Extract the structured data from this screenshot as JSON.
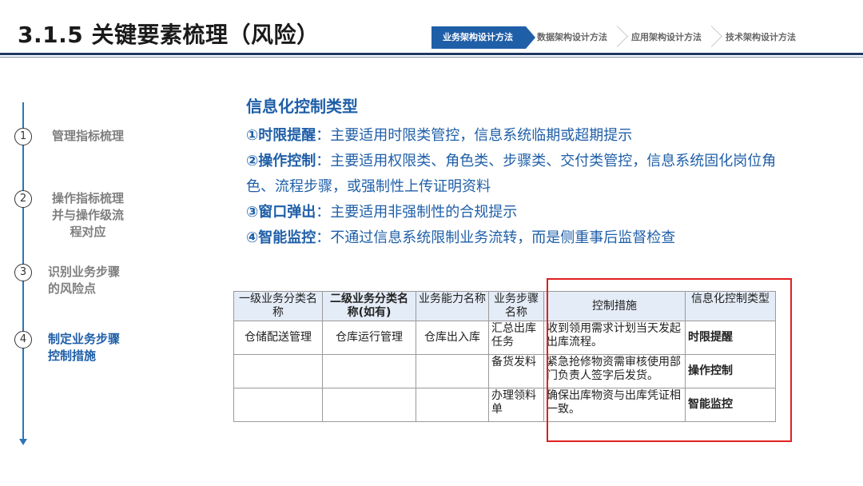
{
  "title": "3.1.5 关键要素梳理（风险）",
  "steps": [
    "业务架构设计方法",
    "数据架构设计方法",
    "应用架构设计方法",
    "技术架构设计方法"
  ],
  "nav": [
    {
      "num": "1",
      "label": "管理指标梳理"
    },
    {
      "num": "2",
      "label": "操作指标梳理并与操作级流程对应"
    },
    {
      "num": "3",
      "label": "识别业务步骤的风险点"
    },
    {
      "num": "4",
      "label": "制定业务步骤控制措施"
    }
  ],
  "content": {
    "heading": "信息化控制类型",
    "items": [
      {
        "key": "①时限提醒",
        "text": "：主要适用时限类管控，信息系统临期或超期提示"
      },
      {
        "key": "②操作控制",
        "text": "：主要适用权限类、角色类、步骤类、交付类管控，信息系统固化岗位角色、流程步骤，或强制性上传证明资料"
      },
      {
        "key": "③窗口弹出",
        "text": "：主要适用非强制性的合规提示"
      },
      {
        "key": "④智能监控",
        "text": "：不通过信息系统限制业务流转，而是侧重事后监督检查"
      }
    ]
  },
  "table": {
    "headers": [
      "一级业务分类名称",
      "二级业务分类名称(如有)",
      "业务能力名称",
      "业务步骤名称",
      "控制措施",
      "信息化控制类型"
    ],
    "rows": [
      [
        "仓储配送管理",
        "仓库运行管理",
        "仓库出入库",
        "汇总出库任务",
        "收到领用需求计划当天发起出库流程。",
        "时限提醒"
      ],
      [
        "",
        "",
        "",
        "备货发料",
        "紧急抢修物资需审核使用部门负责人签字后发货。",
        "操作控制"
      ],
      [
        "",
        "",
        "",
        "办理领料单",
        "确保出库物资与出库凭证相一致。",
        "智能监控"
      ]
    ]
  }
}
